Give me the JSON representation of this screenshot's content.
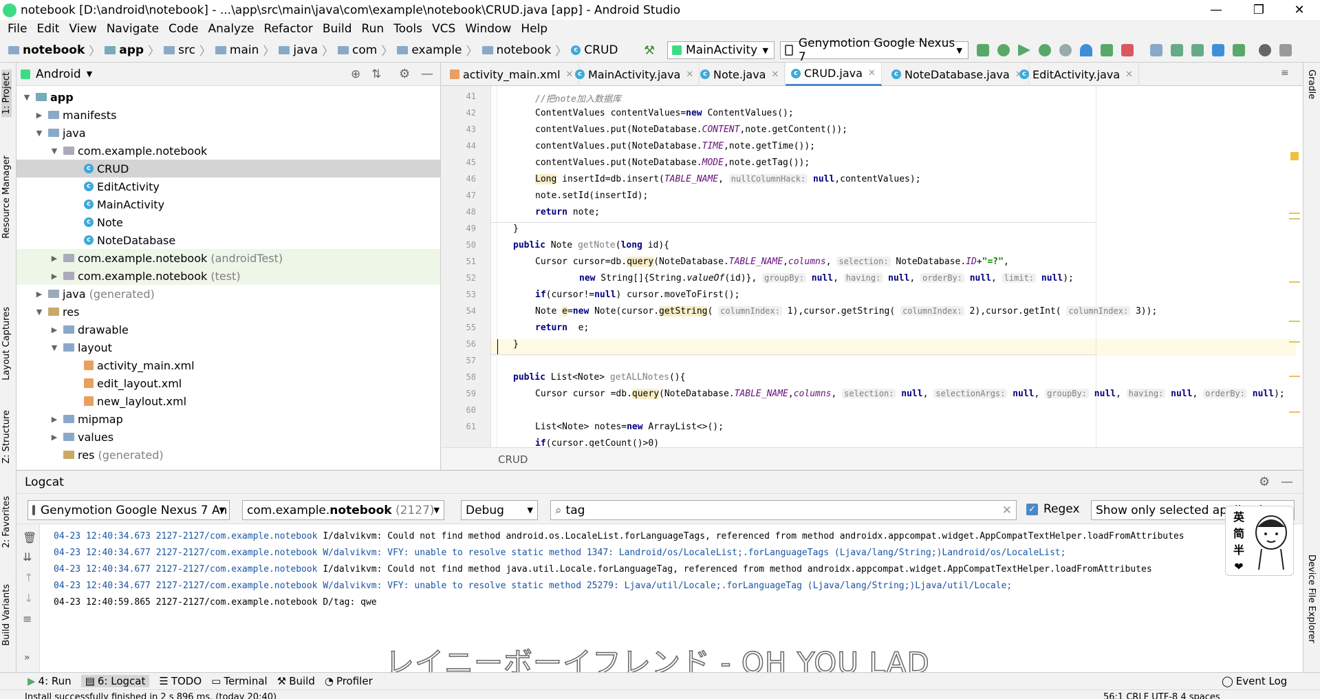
{
  "window": {
    "title": "notebook [D:\\android\\notebook] - ...\\app\\src\\main\\java\\com\\example\\notebook\\CRUD.java [app] - Android Studio"
  },
  "menu": [
    "File",
    "Edit",
    "View",
    "Navigate",
    "Code",
    "Analyze",
    "Refactor",
    "Build",
    "Run",
    "Tools",
    "VCS",
    "Window",
    "Help"
  ],
  "breadcrumb": [
    "notebook",
    "app",
    "src",
    "main",
    "java",
    "com",
    "example",
    "notebook",
    "CRUD"
  ],
  "toolbar": {
    "run_config": "MainActivity",
    "device": "Genymotion Google Nexus 7"
  },
  "left_strip": [
    "1: Project",
    "Resource Manager",
    "Layout Captures",
    "Z: Structure",
    "2: Favorites",
    "Build Variants"
  ],
  "right_strip": [
    "Gradle",
    "Device File Explorer"
  ],
  "project": {
    "view": "Android",
    "tree": [
      {
        "label": "app",
        "bold": true
      },
      {
        "label": "manifests"
      },
      {
        "label": "java"
      },
      {
        "label": "com.example.notebook"
      },
      {
        "label": "CRUD"
      },
      {
        "label": "EditActivity"
      },
      {
        "label": "MainActivity"
      },
      {
        "label": "Note"
      },
      {
        "label": "NoteDatabase"
      },
      {
        "label": "com.example.notebook",
        "suffix": "(androidTest)"
      },
      {
        "label": "com.example.notebook",
        "suffix": "(test)"
      },
      {
        "label": "java",
        "suffix": "(generated)"
      },
      {
        "label": "res"
      },
      {
        "label": "drawable"
      },
      {
        "label": "layout"
      },
      {
        "label": "activity_main.xml"
      },
      {
        "label": "edit_layout.xml"
      },
      {
        "label": "new_laylout.xml"
      },
      {
        "label": "mipmap"
      },
      {
        "label": "values"
      },
      {
        "label": "res",
        "suffix": "(generated)"
      }
    ]
  },
  "editor": {
    "tabs": [
      "activity_main.xml",
      "MainActivity.java",
      "Note.java",
      "CRUD.java",
      "NoteDatabase.java",
      "EditActivity.java"
    ],
    "active_tab": "CRUD.java",
    "line_numbers": [
      "",
      "41",
      "42",
      "43",
      "44",
      "45",
      "46",
      "47",
      "48",
      "49",
      "50",
      "51",
      "52",
      "53",
      "54",
      "55",
      "56",
      "57",
      "58",
      "59",
      "60",
      "61"
    ],
    "footer": "CRUD"
  },
  "logcat": {
    "title": "Logcat",
    "device": "Genymotion Google Nexus 7 An",
    "package_prefix": "com.example.",
    "package_bold": "notebook",
    "package_pid": "(2127)",
    "level": "Debug",
    "search": "tag",
    "regex_label": "Regex",
    "filter": "Show only selected application",
    "lines": [
      {
        "ts": "04-23 12:40:34.673 2127-2127/com.example.notebook",
        "msg": " I/dalvikvm: Could not find method android.os.LocaleList.forLanguageTags, referenced from method androidx.appcompat.widget.AppCompatTextHelper.loadFromAttributes"
      },
      {
        "ts": "04-23 12:40:34.677 2127-2127/com.example.notebook",
        "msg": " W/dalvikvm: VFY: unable to resolve static method 1347: Landroid/os/LocaleList;.forLanguageTags (Ljava/lang/String;)Landroid/os/LocaleList;"
      },
      {
        "ts": "04-23 12:40:34.677 2127-2127/com.example.notebook",
        "msg": " I/dalvikvm: Could not find method java.util.Locale.forLanguageTag, referenced from method androidx.appcompat.widget.AppCompatTextHelper.loadFromAttributes"
      },
      {
        "ts": "04-23 12:40:34.677 2127-2127/com.example.notebook",
        "msg": " W/dalvikvm: VFY: unable to resolve static method 25279: Ljava/util/Locale;.forLanguageTag (Ljava/lang/String;)Ljava/util/Locale;"
      },
      {
        "ts": "04-23 12:40:59.865 2127-2127/com.example.notebook",
        "msg": " D/tag: qwe"
      }
    ]
  },
  "bottom_tabs": [
    "4: Run",
    "6: Logcat",
    "TODO",
    "Terminal",
    "Build",
    "Profiler"
  ],
  "event_log": "Event Log",
  "status": "Install successfully finished in 2 s 896 ms. (today 20:40)",
  "status_right": "56:1   CRLF   UTF-8   4 spaces",
  "overlay_lyric": "レイニーボーイフレンド - OH YOU LAD",
  "sticker_text": [
    "英",
    "简",
    "半"
  ]
}
